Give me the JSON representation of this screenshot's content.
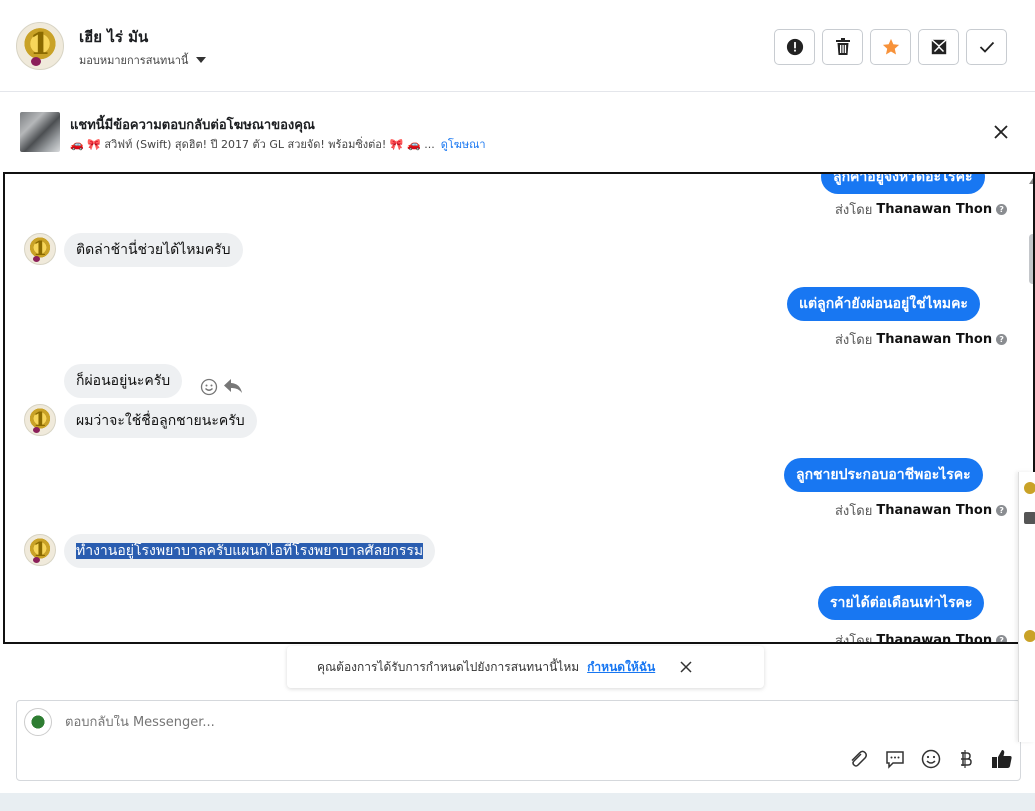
{
  "header": {
    "name": "เฮีย ไร่ มัน",
    "assign_label": "มอบหมายการสนทนานี้",
    "avatar_text": "1"
  },
  "ad": {
    "title": "แชทนี้มีข้อความตอบกลับต่อโฆษณาของคุณ",
    "subtitle": "🚗 🎀 สวิฟท์ (Swift) สุดฮิต! ปี 2017 ตัว GL สวยจัด! พร้อมซิ่งต่อ! 🎀 🚗 ...",
    "link": "ดูโฆษณา"
  },
  "messages": {
    "out0": "ลูกค้าอยู่จังหวัดอะไรคะ",
    "sent_by": "ส่งโดย",
    "agent": "Thanawan Thon",
    "in1": "ติดล่าช้านี่ช่วยได้ไหมครับ",
    "out1": "แต่ลูกค้ายังผ่อนอยู่ใช่ไหมคะ",
    "in2": "ก็ผ่อนอยู่นะครับ",
    "in3": "ผมว่าจะใช้ชื่อลูกชายนะครับ",
    "out2": "ลูกชายประกอบอาชีพอะไรคะ",
    "in4": "ทำงานอยู่โรงพยาบาลครับแผนกไอทีโรงพยาบาลศัลยกรรม",
    "out3": "รายได้ต่อเดือนเท่าไรคะ"
  },
  "toast": {
    "text": "คุณต้องการได้รับการกำหนดไปยังการสนทนานี้ไหม",
    "cta": "กำหนดให้ฉัน"
  },
  "composer": {
    "placeholder": "ตอบกลับใน Messenger..."
  },
  "icons": {
    "header_buttons": [
      "spam-icon",
      "trash-icon",
      "star-icon",
      "mark-unread-icon",
      "done-icon"
    ],
    "tools": [
      "attach-icon",
      "saved-reply-icon",
      "emoji-icon",
      "currency-icon",
      "like-icon"
    ]
  },
  "colors": {
    "accent": "#1877f2",
    "star": "#f7923a",
    "selection": "#2a5db0",
    "incoming_bubble": "#eef0f2"
  }
}
